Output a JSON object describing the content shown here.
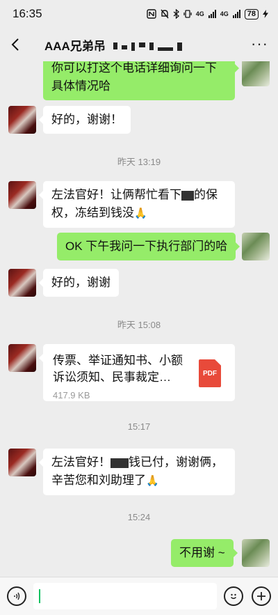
{
  "status_bar": {
    "time": "16:35",
    "network_1": "4G",
    "network_2": "4G",
    "battery": "78"
  },
  "header": {
    "title": "AAA兄弟吊"
  },
  "messages": [
    {
      "type": "out",
      "text": "你可以打这个电话详细询问一下具体情况哈"
    },
    {
      "type": "in",
      "text": "好的，谢谢！"
    },
    {
      "type": "time",
      "text": "昨天 13:19"
    },
    {
      "type": "in",
      "text_a": "左法官好！让俩帮忙看下",
      "text_b": "的保权，冻结到钱没"
    },
    {
      "type": "out",
      "text": "OK 下午我问一下执行部门的哈"
    },
    {
      "type": "in",
      "text": "好的，谢谢"
    },
    {
      "type": "time",
      "text": "昨天 15:08"
    },
    {
      "type": "file",
      "name": "传票、举证通知书、小额诉讼须知、民事裁定…",
      "size": "417.9 KB",
      "icon_label": "PDF"
    },
    {
      "type": "time",
      "text": "15:17"
    },
    {
      "type": "in",
      "text_a": "左法官好！",
      "text_b": "钱已付，谢谢俩，辛苦您和刘助理了"
    },
    {
      "type": "time",
      "text": "15:24"
    },
    {
      "type": "out",
      "text": "不用谢 ~"
    }
  ],
  "icons": {
    "back": "chevron-left-icon",
    "more": "more-icon",
    "voice": "voice-icon",
    "emoji": "emoji-icon",
    "plus": "plus-icon",
    "pdf": "pdf-file-icon",
    "salute": "folded-hands-emoji"
  },
  "colors": {
    "background": "#ededed",
    "out_bubble": "#95ec69",
    "in_bubble": "#ffffff",
    "pdf_red": "#e84a3a",
    "cursor": "#07c160"
  }
}
